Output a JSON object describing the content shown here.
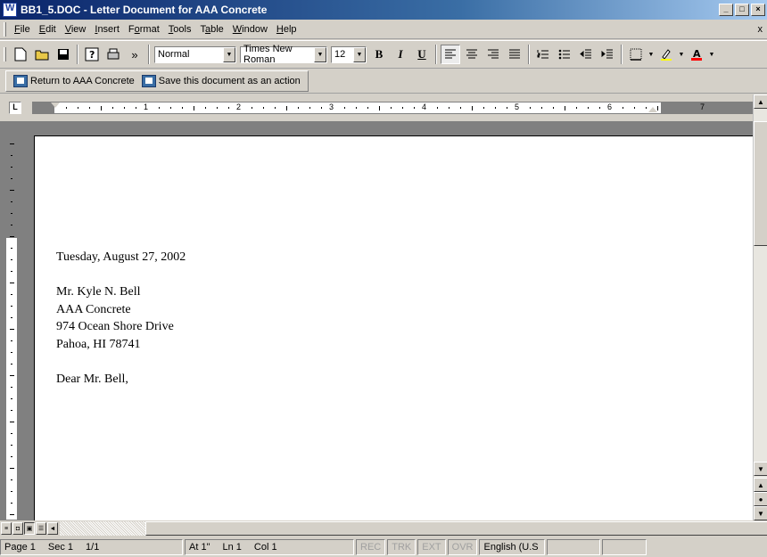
{
  "window": {
    "title": "BB1_5.DOC - Letter Document for AAA Concrete",
    "minimize": "_",
    "maximize": "□",
    "close": "×"
  },
  "menubar": {
    "items": [
      "File",
      "Edit",
      "View",
      "Insert",
      "Format",
      "Tools",
      "Table",
      "Window",
      "Help"
    ],
    "underline": [
      "F",
      "E",
      "V",
      "I",
      "o",
      "T",
      "a",
      "W",
      "H"
    ],
    "close_doc": "x"
  },
  "toolbar": {
    "more_glyph": "»",
    "style": "Normal",
    "font": "Times New Roman",
    "size": "12",
    "bold": "B",
    "italic": "I",
    "underline": "U"
  },
  "actionbar": {
    "return_label": "Return to AAA Concrete",
    "save_action_label": "Save this document as an action"
  },
  "ruler": {
    "tab_selector": "L",
    "numbers": [
      "1",
      "2",
      "3",
      "4",
      "5",
      "6",
      "7"
    ]
  },
  "letter": {
    "date": "Tuesday, August 27, 2002",
    "recipient_name": "Mr. Kyle N. Bell",
    "company": "AAA Concrete",
    "street": "974 Ocean Shore Drive",
    "city_state_zip": "Pahoa, HI 78741",
    "salutation": "Dear Mr. Bell,"
  },
  "status": {
    "page": "Page 1",
    "sec": "Sec 1",
    "page_of": "1/1",
    "at": "At 1\"",
    "ln": "Ln 1",
    "col": "Col 1",
    "rec": "REC",
    "trk": "TRK",
    "ext": "EXT",
    "ovr": "OVR",
    "language": "English (U.S"
  }
}
